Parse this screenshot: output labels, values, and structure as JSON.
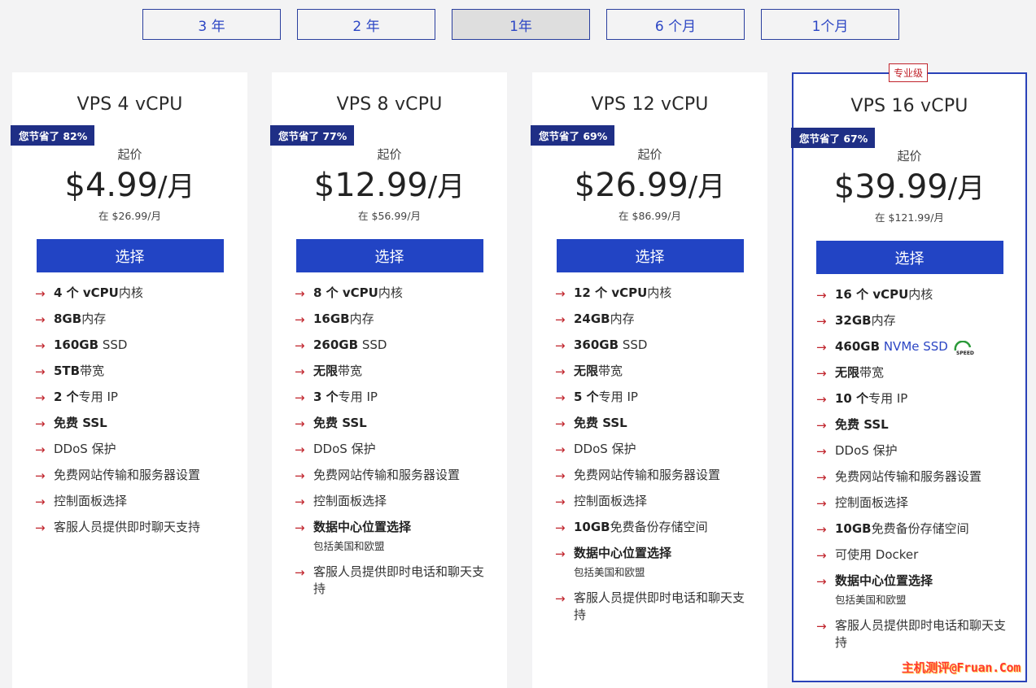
{
  "terms": [
    {
      "label": "3 年",
      "active": false
    },
    {
      "label": "2 年",
      "active": false
    },
    {
      "label": "1年",
      "active": true
    },
    {
      "label": "6 个月",
      "active": false
    },
    {
      "label": "1个月",
      "active": false
    }
  ],
  "colors": {
    "accent": "#2244c4",
    "badge": "#1f2f86",
    "arrow": "#c0232b"
  },
  "plans": [
    {
      "title": "VPS 4 vCPU",
      "badge": "您节省了 82%",
      "from": "起价",
      "price": "$4.99",
      "unit": "/月",
      "orig": "在 $26.99/月",
      "select": "选择",
      "features": [
        {
          "bold": "4 个 vCPU",
          "text": "内核"
        },
        {
          "bold": "8GB",
          "text": "内存"
        },
        {
          "bold": "160GB",
          "text": " SSD"
        },
        {
          "bold": "5TB",
          "text": "带宽"
        },
        {
          "bold": "2 个",
          "text": "专用 IP"
        },
        {
          "bold": "免费 SSL",
          "text": ""
        },
        {
          "bold": "",
          "text": "DDoS 保护"
        },
        {
          "bold": "",
          "text": "免费网站传输和服务器设置"
        },
        {
          "bold": "",
          "text": "控制面板选择"
        },
        {
          "bold": "",
          "text": "客服人员提供即时聊天支持"
        }
      ]
    },
    {
      "title": "VPS 8 vCPU",
      "badge": "您节省了 77%",
      "from": "起价",
      "price": "$12.99",
      "unit": "/月",
      "orig": "在 $56.99/月",
      "select": "选择",
      "features": [
        {
          "bold": "8 个 vCPU",
          "text": "内核"
        },
        {
          "bold": "16GB",
          "text": "内存"
        },
        {
          "bold": "260GB",
          "text": " SSD"
        },
        {
          "bold": "无限",
          "text": "带宽"
        },
        {
          "bold": "3 个",
          "text": "专用 IP"
        },
        {
          "bold": "免费 SSL",
          "text": ""
        },
        {
          "bold": "",
          "text": "DDoS 保护"
        },
        {
          "bold": "",
          "text": "免费网站传输和服务器设置"
        },
        {
          "bold": "",
          "text": "控制面板选择"
        },
        {
          "bold": "数据中心位置选择",
          "text": "",
          "sub": "包括美国和欧盟"
        },
        {
          "bold": "",
          "text": "客服人员提供即时电话和聊天支持"
        }
      ]
    },
    {
      "title": "VPS 12 vCPU",
      "badge": "您节省了 69%",
      "from": "起价",
      "price": "$26.99",
      "unit": "/月",
      "orig": "在 $86.99/月",
      "select": "选择",
      "features": [
        {
          "bold": "12 个 vCPU",
          "text": "内核"
        },
        {
          "bold": "24GB",
          "text": "内存"
        },
        {
          "bold": "360GB",
          "text": " SSD"
        },
        {
          "bold": "无限",
          "text": "带宽"
        },
        {
          "bold": "5 个",
          "text": "专用 IP"
        },
        {
          "bold": "免费 SSL",
          "text": ""
        },
        {
          "bold": "",
          "text": "DDoS 保护"
        },
        {
          "bold": "",
          "text": "免费网站传输和服务器设置"
        },
        {
          "bold": "",
          "text": "控制面板选择"
        },
        {
          "bold": "10GB",
          "text": "免费备份存储空间"
        },
        {
          "bold": "数据中心位置选择",
          "text": "",
          "sub": "包括美国和欧盟"
        },
        {
          "bold": "",
          "text": "客服人员提供即时电话和聊天支持"
        }
      ]
    },
    {
      "title": "VPS 16 vCPU",
      "tag": "专业级",
      "badge": "您节省了 67%",
      "from": "起价",
      "price": "$39.99",
      "unit": "/月",
      "orig": "在 $121.99/月",
      "select": "选择",
      "features": [
        {
          "bold": "16 个 vCPU",
          "text": "内核"
        },
        {
          "bold": "32GB",
          "text": "内存"
        },
        {
          "bold": "460GB",
          "nvme": " NVMe SSD",
          "speed": "SPEED"
        },
        {
          "bold": "无限",
          "text": "带宽"
        },
        {
          "bold": "10 个",
          "text": "专用 IP"
        },
        {
          "bold": "免费 SSL",
          "text": ""
        },
        {
          "bold": "",
          "text": "DDoS 保护"
        },
        {
          "bold": "",
          "text": "免费网站传输和服务器设置"
        },
        {
          "bold": "",
          "text": "控制面板选择"
        },
        {
          "bold": "10GB",
          "text": "免费备份存储空间"
        },
        {
          "bold": "",
          "text": "可使用 Docker"
        },
        {
          "bold": "数据中心位置选择",
          "text": "",
          "sub": "包括美国和欧盟"
        },
        {
          "bold": "",
          "text": "客服人员提供即时电话和聊天支持"
        }
      ]
    }
  ],
  "watermark": "主机测评@Fruan.Com"
}
